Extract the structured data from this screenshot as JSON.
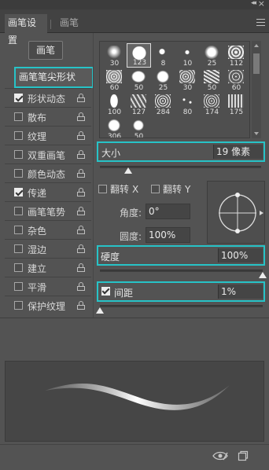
{
  "window": {
    "collapse_glyph": "◂◂",
    "close_glyph": "×",
    "menu_icon": "panel-menu-icon"
  },
  "tabs": [
    {
      "label": "画笔设置",
      "active": true
    },
    {
      "label": "画笔",
      "active": false
    }
  ],
  "preset_button": {
    "label": "画笔"
  },
  "brush_tip_shape": {
    "label": "画笔笔尖形状"
  },
  "options": [
    {
      "label": "形状动态",
      "checked": true
    },
    {
      "label": "散布",
      "checked": false
    },
    {
      "label": "纹理",
      "checked": false
    },
    {
      "label": "双重画笔",
      "checked": false
    },
    {
      "label": "颜色动态",
      "checked": false
    },
    {
      "label": "传递",
      "checked": true
    },
    {
      "label": "画笔笔势",
      "checked": false
    },
    {
      "label": "杂色",
      "checked": false
    },
    {
      "label": "湿边",
      "checked": false
    },
    {
      "label": "建立",
      "checked": false
    },
    {
      "label": "平滑",
      "checked": false
    },
    {
      "label": "保护纹理",
      "checked": false
    }
  ],
  "brush_grid": {
    "sizes": [
      "30",
      "123",
      "8",
      "10",
      "25",
      "112",
      "60",
      "50",
      "25",
      "30",
      "50",
      "60",
      "100",
      "127",
      "284",
      "80",
      "174",
      "175",
      "306",
      "50"
    ],
    "selected_index": 1
  },
  "size": {
    "label": "大小",
    "value": "19 像素",
    "level": 0.1
  },
  "flip_x": {
    "label": "翻转",
    "axis": "X",
    "checked": false
  },
  "flip_y": {
    "label": "翻转",
    "axis": "Y",
    "checked": false
  },
  "angle": {
    "label": "角度:",
    "value": "0°"
  },
  "roundness": {
    "label": "圆度:",
    "value": "100%"
  },
  "hardness": {
    "label": "硬度",
    "value": "100%",
    "level": 1.0
  },
  "spacing": {
    "label": "间距",
    "value": "1%",
    "checked": true,
    "level": 0.0
  },
  "footer": {
    "visibility_icon": "eye-toggle-icon",
    "new_icon": "new-preset-icon"
  }
}
